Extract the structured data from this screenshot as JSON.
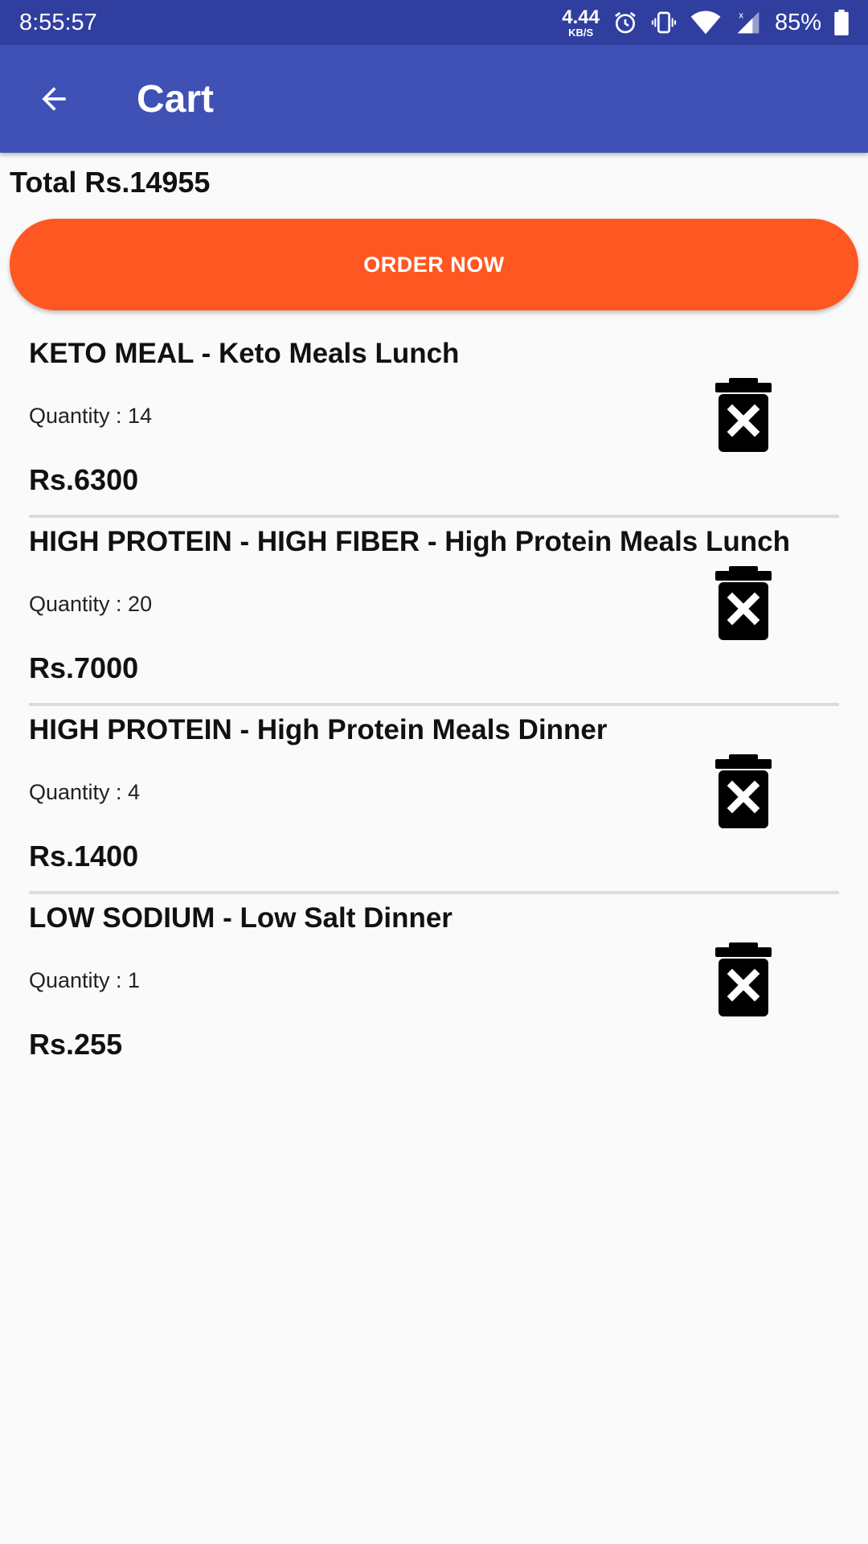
{
  "status_bar": {
    "time": "8:55:57",
    "net_speed_value": "4.44",
    "net_speed_unit": "KB/S",
    "battery": "85%",
    "icons": [
      "alarm-icon",
      "vibrate-icon",
      "wifi-icon",
      "signal-icon",
      "battery-icon"
    ]
  },
  "app_bar": {
    "title": "Cart",
    "back_icon": "arrow-back-icon"
  },
  "cart": {
    "total_label": "Total Rs.14955",
    "order_button_label": "ORDER NOW",
    "items": [
      {
        "name": "KETO MEAL - Keto Meals  Lunch",
        "quantity": "Quantity : 14",
        "price": "Rs.6300"
      },
      {
        "name": "HIGH PROTEIN - HIGH FIBER - High Protein Meals  Lunch",
        "quantity": "Quantity : 20",
        "price": "Rs.7000"
      },
      {
        "name": "HIGH PROTEIN - High Protein Meals Dinner",
        "quantity": "Quantity : 4",
        "price": "Rs.1400"
      },
      {
        "name": "LOW SODIUM - Low Salt  Dinner",
        "quantity": "Quantity : 1",
        "price": "Rs.255"
      }
    ]
  },
  "colors": {
    "status_bar": "#303f9f",
    "app_bar": "#3f51b5",
    "order_button": "#ff5722",
    "background": "#fafafa"
  }
}
